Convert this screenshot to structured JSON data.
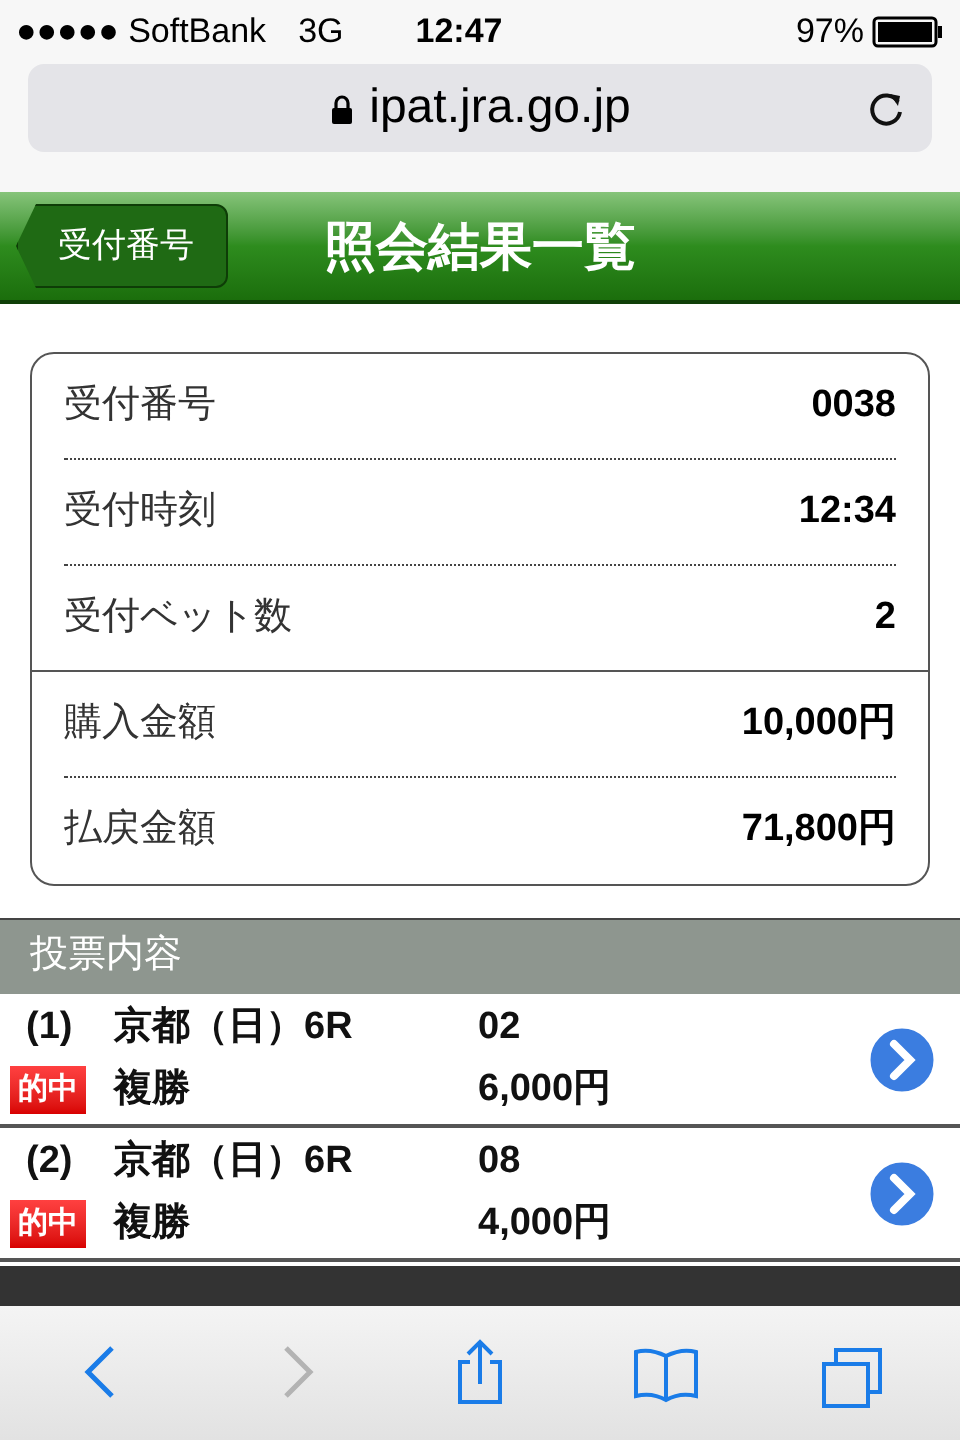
{
  "status_bar": {
    "carrier": "●●●●● SoftBank",
    "network": "3G",
    "time": "12:47",
    "battery": "97%"
  },
  "address_bar": {
    "url": "ipat.jra.go.jp"
  },
  "header": {
    "back_button": "受付番号",
    "title": "照会結果一覧"
  },
  "summary": {
    "groups": [
      [
        {
          "label": "受付番号",
          "value": "0038"
        },
        {
          "label": "受付時刻",
          "value": "12:34"
        },
        {
          "label": "受付ベット数",
          "value": "2"
        }
      ],
      [
        {
          "label": "購入金額",
          "value": "10,000円"
        },
        {
          "label": "払戻金額",
          "value": "71,800円"
        }
      ]
    ]
  },
  "section_title": "投票内容",
  "bets": [
    {
      "number": "(1)",
      "race": "京都（日）6R",
      "type": "複勝",
      "horse": "02",
      "amount": "6,000円",
      "hit": true,
      "hit_label": "的中"
    },
    {
      "number": "(2)",
      "race": "京都（日）6R",
      "type": "複勝",
      "horse": "08",
      "amount": "4,000円",
      "hit": true,
      "hit_label": "的中"
    }
  ],
  "toolbar": [
    {
      "kind": "back",
      "disabled": false
    },
    {
      "kind": "forward",
      "disabled": true
    },
    {
      "kind": "share",
      "disabled": false
    },
    {
      "kind": "bookmarks",
      "disabled": false
    },
    {
      "kind": "tabs",
      "disabled": false
    }
  ]
}
